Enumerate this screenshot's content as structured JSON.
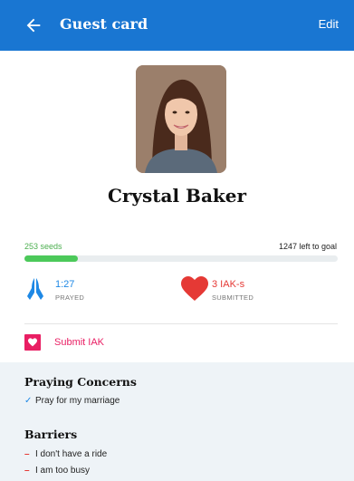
{
  "appbar": {
    "title": "Guest card",
    "edit_label": "Edit",
    "back_icon": "arrow-left-icon",
    "color": "#1976d2"
  },
  "guest": {
    "name": "Crystal Baker"
  },
  "seeds": {
    "count_label": "253 seeds",
    "left_label": "1247 left to goal",
    "progress": 0.17
  },
  "stats": {
    "prayed": {
      "value": "1:27",
      "label": "PRAYED",
      "icon": "praying-hands-icon"
    },
    "iak": {
      "value": "3 IAK-s",
      "label": "SUBMITTED",
      "icon": "heart-icon"
    }
  },
  "submit": {
    "label": "Submit IAK",
    "icon": "heart-box-icon",
    "color": "#e91e63"
  },
  "concerns": {
    "title": "Praying Concerns",
    "items": [
      "Pray for my marriage"
    ]
  },
  "barriers": {
    "title": "Barriers",
    "items": [
      "I don't have a ride",
      "I am too busy"
    ]
  }
}
